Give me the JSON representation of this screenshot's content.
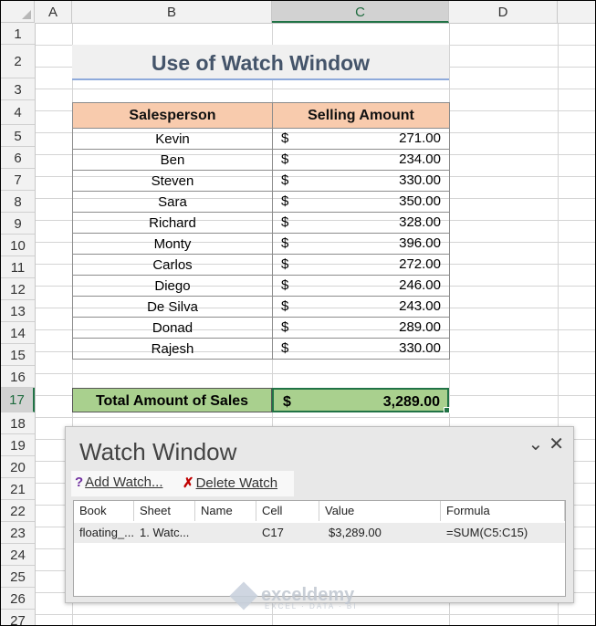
{
  "columns": [
    "A",
    "B",
    "C",
    "D"
  ],
  "rows": [
    "1",
    "2",
    "3",
    "4",
    "5",
    "6",
    "7",
    "8",
    "9",
    "10",
    "11",
    "12",
    "13",
    "14",
    "15",
    "16",
    "17",
    "18",
    "19",
    "20",
    "21",
    "22",
    "23",
    "24",
    "25",
    "26",
    "27"
  ],
  "title": "Use of Watch Window",
  "table": {
    "headers": [
      "Salesperson",
      "Selling Amount"
    ],
    "currency": "$",
    "rows": [
      {
        "name": "Kevin",
        "amount": "271.00"
      },
      {
        "name": "Ben",
        "amount": "234.00"
      },
      {
        "name": "Steven",
        "amount": "330.00"
      },
      {
        "name": "Sara",
        "amount": "350.00"
      },
      {
        "name": "Richard",
        "amount": "328.00"
      },
      {
        "name": "Monty",
        "amount": "396.00"
      },
      {
        "name": "Carlos",
        "amount": "272.00"
      },
      {
        "name": "Diego",
        "amount": "246.00"
      },
      {
        "name": "De Silva",
        "amount": "243.00"
      },
      {
        "name": "Donad",
        "amount": "289.00"
      },
      {
        "name": "Rajesh",
        "amount": "330.00"
      }
    ]
  },
  "total": {
    "label": "Total Amount of Sales",
    "currency": "$",
    "value": "3,289.00"
  },
  "watch_window": {
    "title": "Watch Window",
    "add_label": "Add Watch...",
    "delete_label": "Delete Watch",
    "columns": [
      "Book",
      "Sheet",
      "Name",
      "Cell",
      "Value",
      "Formula"
    ],
    "row": {
      "book": "floating_...",
      "sheet": "1. Watc...",
      "name": "",
      "cell": "C17",
      "value": "$3,289.00",
      "formula": "=SUM(C5:C15)"
    }
  },
  "watermark": {
    "brand": "exceldemy",
    "tagline": "EXCEL · DATA · BI"
  },
  "colors": {
    "header_fill": "#f8cbad",
    "total_fill": "#a9d08e",
    "selection": "#217346",
    "title_text": "#44546a"
  }
}
